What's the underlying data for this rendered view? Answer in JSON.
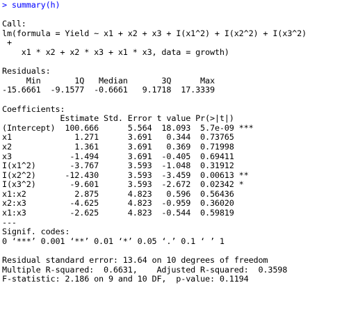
{
  "command": {
    "prompt": ">",
    "text": "summary(h)"
  },
  "call": {
    "header": "Call:",
    "lines": [
      "lm(formula = Yield ~ x1 + x2 + x3 + I(x1^2) + I(x2^2) + I(x3^2)",
      " +",
      "    x1 * x2 + x2 * x3 + x1 * x3, data = growth)"
    ]
  },
  "residuals": {
    "header": "Residuals:",
    "columns_line": "     Min       1Q   Median       3Q      Max ",
    "values_line": "-15.6661  -9.1577  -0.6661   9.1718  17.3339 "
  },
  "coefficients": {
    "header": "Coefficients:",
    "column_header_line": "            Estimate Std. Error t value Pr(>|t|)    ",
    "rows": [
      {
        "term": "(Intercept)",
        "estimate": "100.666",
        "std_error": "5.564",
        "t_value": "18.093",
        "p_value": "5.7e-09",
        "signif": "***",
        "line": "(Intercept)  100.666      5.564  18.093  5.7e-09 ***"
      },
      {
        "term": "x1",
        "estimate": "1.271",
        "std_error": "3.691",
        "t_value": "0.344",
        "p_value": "0.73765",
        "signif": "",
        "line": "x1             1.271      3.691   0.344  0.73765    "
      },
      {
        "term": "x2",
        "estimate": "1.361",
        "std_error": "3.691",
        "t_value": "0.369",
        "p_value": "0.71998",
        "signif": "",
        "line": "x2             1.361      3.691   0.369  0.71998    "
      },
      {
        "term": "x3",
        "estimate": "-1.494",
        "std_error": "3.691",
        "t_value": "-0.405",
        "p_value": "0.69411",
        "signif": "",
        "line": "x3            -1.494      3.691  -0.405  0.69411    "
      },
      {
        "term": "I(x1^2)",
        "estimate": "-3.767",
        "std_error": "3.593",
        "t_value": "-1.048",
        "p_value": "0.31912",
        "signif": "",
        "line": "I(x1^2)       -3.767      3.593  -1.048  0.31912    "
      },
      {
        "term": "I(x2^2)",
        "estimate": "-12.430",
        "std_error": "3.593",
        "t_value": "-3.459",
        "p_value": "0.00613",
        "signif": "**",
        "line": "I(x2^2)      -12.430      3.593  -3.459  0.00613 ** "
      },
      {
        "term": "I(x3^2)",
        "estimate": "-9.601",
        "std_error": "3.593",
        "t_value": "-2.672",
        "p_value": "0.02342",
        "signif": "*",
        "line": "I(x3^2)       -9.601      3.593  -2.672  0.02342 *  "
      },
      {
        "term": "x1:x2",
        "estimate": "2.875",
        "std_error": "4.823",
        "t_value": "0.596",
        "p_value": "0.56436",
        "signif": "",
        "line": "x1:x2          2.875      4.823   0.596  0.56436    "
      },
      {
        "term": "x2:x3",
        "estimate": "-4.625",
        "std_error": "4.823",
        "t_value": "-0.959",
        "p_value": "0.36020",
        "signif": "",
        "line": "x2:x3         -4.625      4.823  -0.959  0.36020    "
      },
      {
        "term": "x1:x3",
        "estimate": "-2.625",
        "std_error": "4.823",
        "t_value": "-0.544",
        "p_value": "0.59819",
        "signif": "",
        "line": "x1:x3         -2.625      4.823  -0.544  0.59819    "
      }
    ],
    "separator": "---"
  },
  "signif_codes": {
    "header": "Signif. codes:",
    "legend": "0 ‘***’ 0.001 ‘**’ 0.01 ‘*’ 0.05 ‘.’ 0.1 ‘ ’ 1"
  },
  "model_stats": {
    "residual_se_line": "Residual standard error: 13.64 on 10 degrees of freedom",
    "r_squared_line": "Multiple R-squared:  0.6631,\tAdjusted R-squared:  0.3598 ",
    "f_statistic_line": "F-statistic: 2.186 on 9 and 10 DF,  p-value: 0.1194"
  },
  "colors": {
    "command": "#0000ff",
    "output": "#000000",
    "background": "#ffffff"
  }
}
